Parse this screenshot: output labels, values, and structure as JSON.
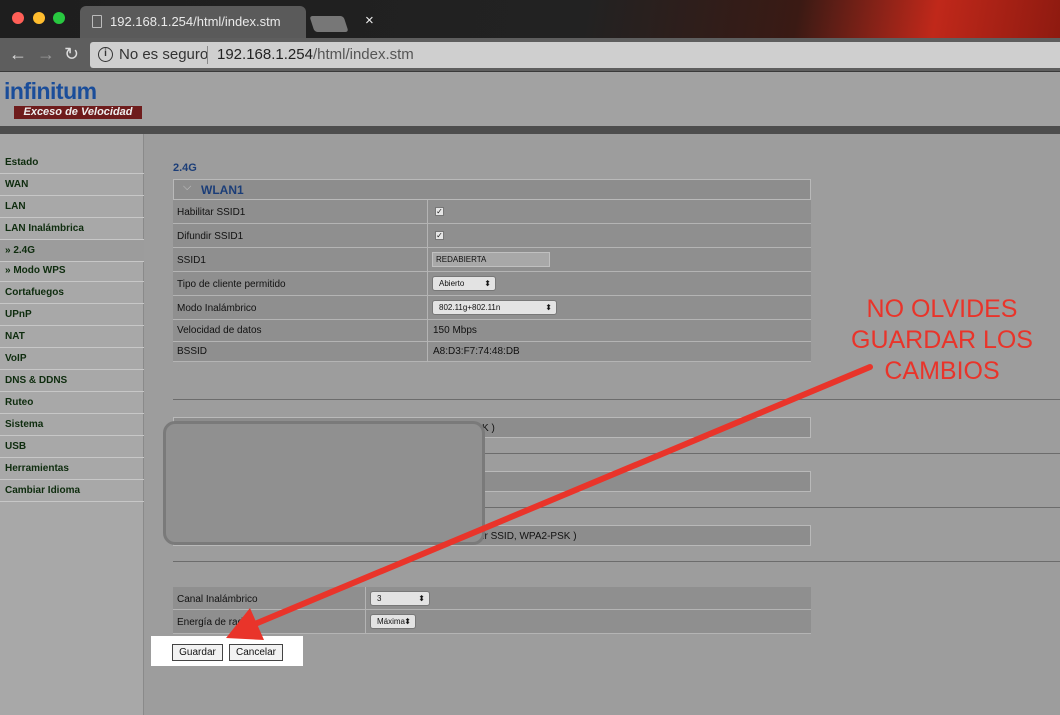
{
  "browser": {
    "tab_title": "192.168.1.254/html/index.stm",
    "close_glyph": "×",
    "back_glyph": "←",
    "forward_glyph": "→",
    "reload_glyph": "↻",
    "info_glyph": "i",
    "security_label": "No es seguro",
    "url_host": "192.168.1.254",
    "url_path": "/html/index.stm"
  },
  "brand": {
    "logo_text": "infinitum",
    "tagline": "Exceso de Velocidad"
  },
  "sidebar": {
    "items": [
      {
        "label": "Estado"
      },
      {
        "label": "WAN"
      },
      {
        "label": "LAN"
      },
      {
        "label": "LAN Inalámbrica"
      },
      {
        "label": "» 2.4G"
      },
      {
        "label": "» Modo WPS"
      },
      {
        "label": "Cortafuegos"
      },
      {
        "label": "UPnP"
      },
      {
        "label": "NAT"
      },
      {
        "label": "VoIP"
      },
      {
        "label": "DNS & DDNS"
      },
      {
        "label": "Ruteo"
      },
      {
        "label": "Sistema"
      },
      {
        "label": "USB"
      },
      {
        "label": "Herramientas"
      },
      {
        "label": "Cambiar Idioma"
      }
    ]
  },
  "main": {
    "section_title": "2.4G",
    "wlan_label": "WLAN1",
    "chevron_glyph": "⌵",
    "rows": {
      "enable_ssid": "Habilitar SSID1",
      "broadcast_ssid": "Difundir SSID1",
      "ssid": "SSID1",
      "client_type": "Tipo de cliente permitido",
      "mode": "Modo Inalámbrico",
      "rate": "Velocidad de datos",
      "bssid": "BSSID"
    },
    "check_glyph": "✓",
    "ssid_value": "REDABIERTA",
    "client_type_value": "Abierto",
    "mode_value": "802.11g+802.11n",
    "rate_value": "150 Mbps",
    "bssid_value": "A8:D3:F7:74:48:DB",
    "select_arrow": "⬍",
    "partial_row_1": "K )",
    "partial_row_3": "difundir SSID, WPA2-PSK )",
    "channel_label": "Canal Inalámbrico",
    "channel_value": "3",
    "power_label": "Energía de radio",
    "power_value": "Máxima",
    "save_label": "Guardar",
    "cancel_label": "Cancelar"
  },
  "annotation": {
    "note": "NO OLVIDES GUARDAR LOS CAMBIOS",
    "color": "#e9342a"
  }
}
